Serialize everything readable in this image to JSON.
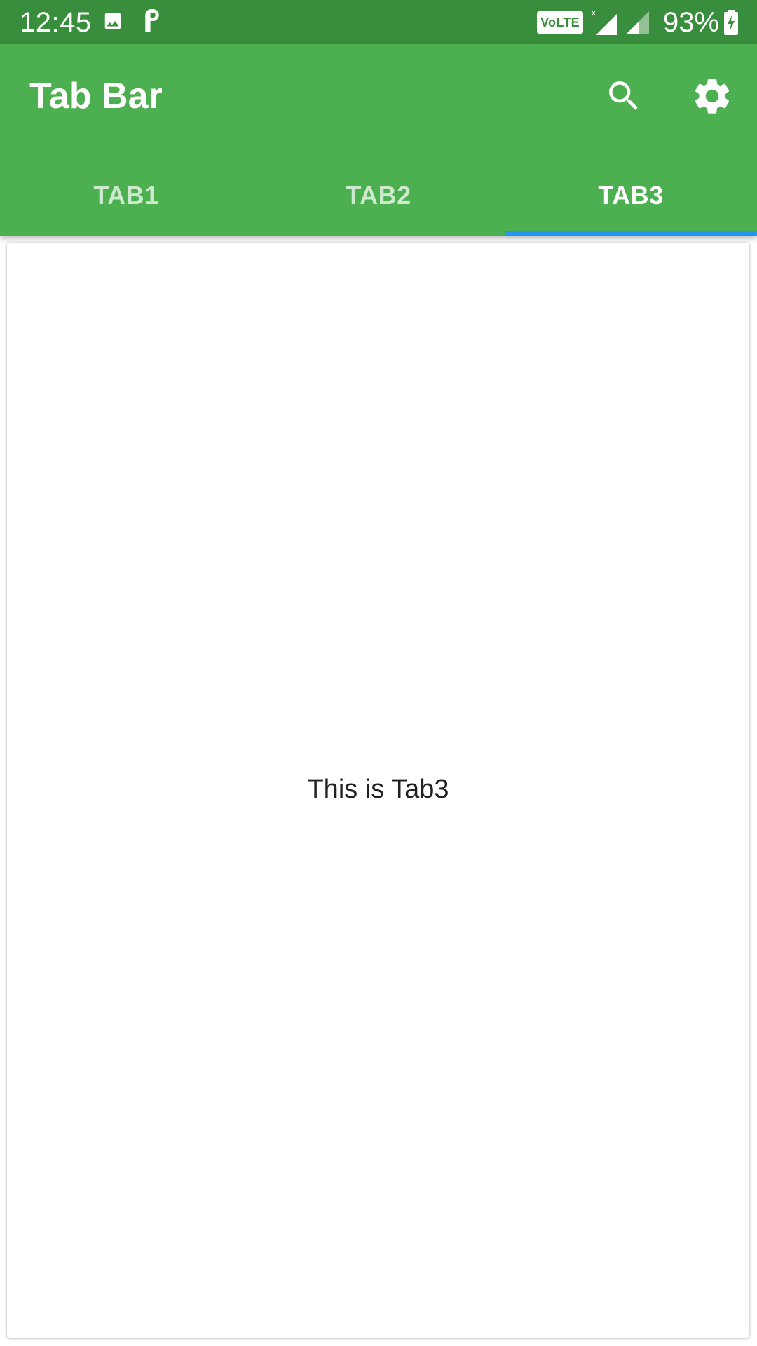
{
  "status_bar": {
    "time": "12:45",
    "icons": [
      "image-icon",
      "parking-icon"
    ],
    "volte": "VoLTE",
    "battery_percent": "93%",
    "colors": {
      "background": "#388e3c"
    }
  },
  "app_bar": {
    "title": "Tab Bar",
    "actions": [
      "search-icon",
      "gear-icon"
    ],
    "colors": {
      "background": "#4caf50",
      "indicator": "#2196f3"
    }
  },
  "tabs": [
    {
      "label": "TAB1",
      "active": false
    },
    {
      "label": "TAB2",
      "active": false
    },
    {
      "label": "TAB3",
      "active": true
    }
  ],
  "content": {
    "text": "This is Tab3"
  }
}
